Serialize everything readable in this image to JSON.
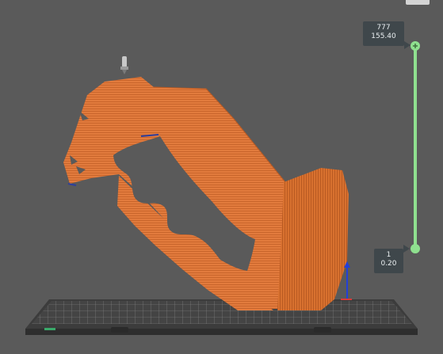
{
  "layer_slider": {
    "top": {
      "layer": "777",
      "height": "155.40"
    },
    "bottom": {
      "layer": "1",
      "height": "0.20"
    },
    "track_color": "#8fe08f",
    "handle_color": "#8fe08f"
  },
  "colors": {
    "background": "#5a5a5a",
    "model": "#e07a3c",
    "model_dark": "#b85a24",
    "bed": "#4a4a4a",
    "grid": "#8a8a8a"
  },
  "icons": [
    "plus-icon",
    "nozzle-icon",
    "axis-z-arrow",
    "axis-x-arrow"
  ]
}
